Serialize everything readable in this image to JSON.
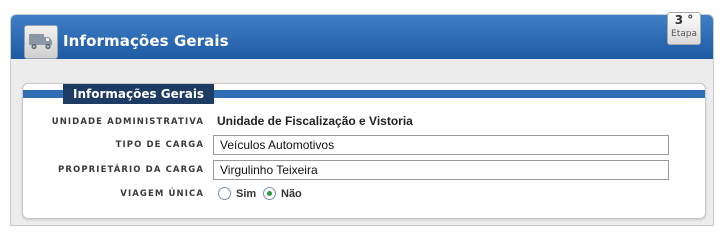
{
  "header": {
    "title": "Informações Gerais",
    "step_number": "3 °",
    "step_label": "Etapa"
  },
  "section": {
    "tab_title": "Informações Gerais"
  },
  "fields": {
    "unidade": {
      "label": "UNIDADE ADMINISTRATIVA",
      "value": "Unidade de Fiscalização e Vistoria"
    },
    "tipo_carga": {
      "label": "TIPO DE CARGA",
      "value": "Veículos Automotivos"
    },
    "proprietario": {
      "label": "PROPRIETÁRIO DA CARGA",
      "value": "Virgulinho Teixeira"
    },
    "viagem_unica": {
      "label": "VIAGEM ÚNICA",
      "options": [
        "Sim",
        "Não"
      ],
      "selected": "Não"
    }
  },
  "colors": {
    "header_blue": "#2a66b0",
    "tab_navy": "#1e3b63",
    "radio_checked": "#2a9a3a"
  },
  "icons": {
    "header": "truck-icon"
  }
}
